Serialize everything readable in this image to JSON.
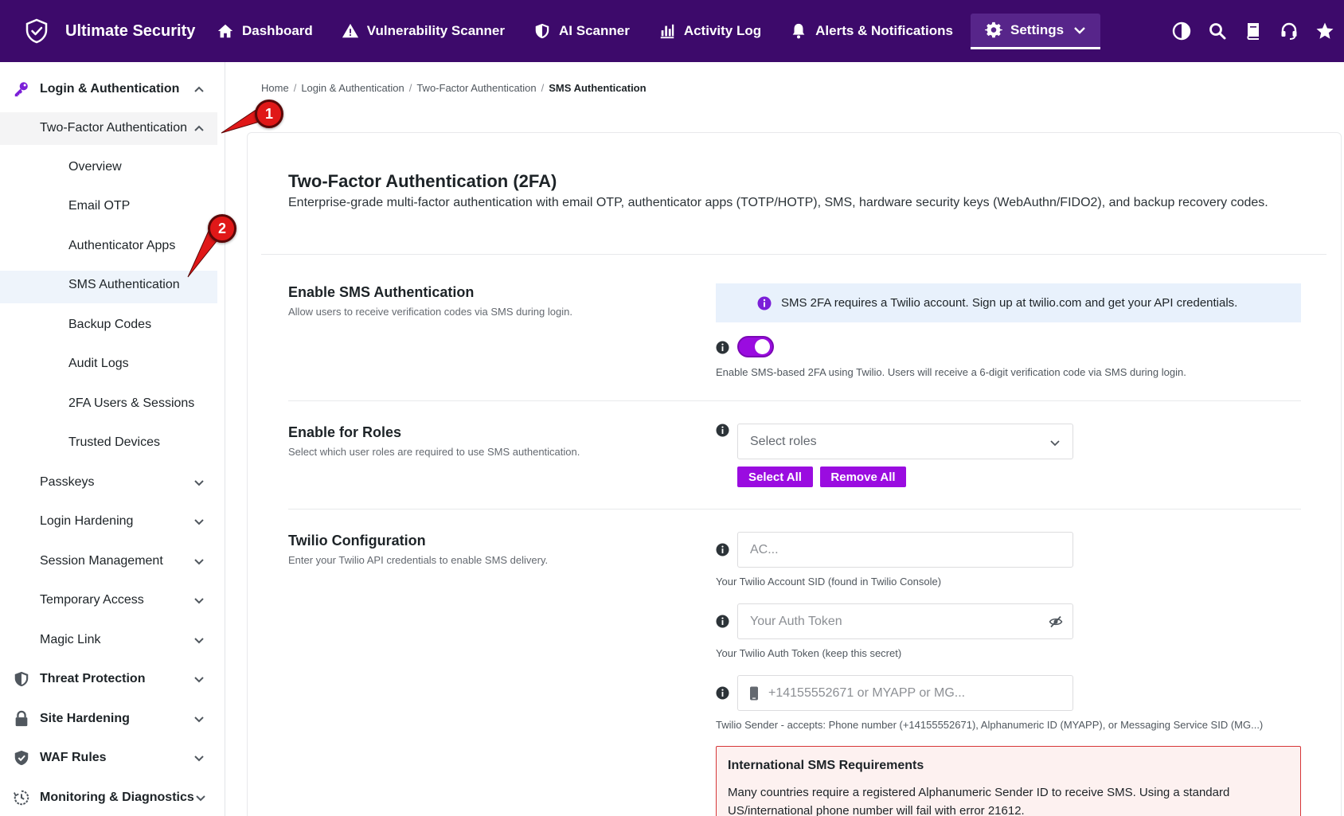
{
  "brand": {
    "name": "Ultimate Security"
  },
  "nav": [
    {
      "label": "Dashboard",
      "icon": "home-icon"
    },
    {
      "label": "Vulnerability Scanner",
      "icon": "warning-icon"
    },
    {
      "label": "AI Scanner",
      "icon": "shield-icon"
    },
    {
      "label": "Activity Log",
      "icon": "bar-chart-icon"
    },
    {
      "label": "Alerts & Notifications",
      "icon": "bell-icon"
    },
    {
      "label": "Settings",
      "icon": "gear-icon"
    }
  ],
  "top_icons": [
    "theme-toggle-icon",
    "search-icon",
    "book-icon",
    "headset-icon",
    "star-icon"
  ],
  "sidebar": {
    "login_auth": "Login & Authentication",
    "two_factor": "Two-Factor Authentication",
    "children": [
      "Overview",
      "Email OTP",
      "Authenticator Apps",
      "SMS Authentication",
      "Backup Codes",
      "Audit Logs",
      "2FA Users & Sessions",
      "Trusted Devices"
    ],
    "subgroups": [
      "Passkeys",
      "Login Hardening",
      "Session Management",
      "Temporary Access",
      "Magic Link"
    ],
    "top_groups": [
      "Threat Protection",
      "Site Hardening",
      "WAF Rules",
      "Monitoring & Diagnostics"
    ]
  },
  "breadcrumb": {
    "items": [
      "Home",
      "Login & Authentication",
      "Two-Factor Authentication"
    ],
    "separator": "/",
    "current": "SMS Authentication"
  },
  "page": {
    "title": "Two-Factor Authentication (2FA)",
    "description": "Enterprise-grade multi-factor authentication with email OTP, authenticator apps (TOTP/HOTP), SMS, hardware security keys (WebAuthn/FIDO2), and backup recovery codes."
  },
  "sms_section": {
    "title": "Enable SMS Authentication",
    "description": "Allow users to receive verification codes via SMS during login.",
    "notice": "SMS 2FA requires a Twilio account. Sign up at twilio.com and get your API credentials.",
    "toggle_on": true,
    "help": "Enable SMS-based 2FA using Twilio. Users will receive a 6-digit verification code via SMS during login."
  },
  "roles_section": {
    "title": "Enable for Roles",
    "description": "Select which user roles are required to use SMS authentication.",
    "placeholder": "Select roles",
    "select_all": "Select All",
    "remove_all": "Remove All"
  },
  "twilio_section": {
    "title": "Twilio Configuration",
    "description": "Enter your Twilio API credentials to enable SMS delivery.",
    "sid_placeholder": "AC...",
    "sid_help": "Your Twilio Account SID (found in Twilio Console)",
    "token_placeholder": "Your Auth Token",
    "token_help": "Your Twilio Auth Token (keep this secret)",
    "sender_placeholder": "+14155552671 or MYAPP or MG...",
    "sender_help": "Twilio Sender - accepts: Phone number (+14155552671), Alphanumeric ID (MYAPP), or Messaging Service SID (MG...)"
  },
  "warning": {
    "title": "International SMS Requirements",
    "body": "Many countries require a registered Alphanumeric Sender ID to receive SMS. Using a standard US/international phone number will fail with error 21612."
  },
  "annotations": [
    "1",
    "2"
  ],
  "colors": {
    "topbar": "#3d0a6b",
    "accent": "#9a0ce0",
    "notice_bg": "#e8f1fc",
    "warning_border": "#d63638"
  }
}
